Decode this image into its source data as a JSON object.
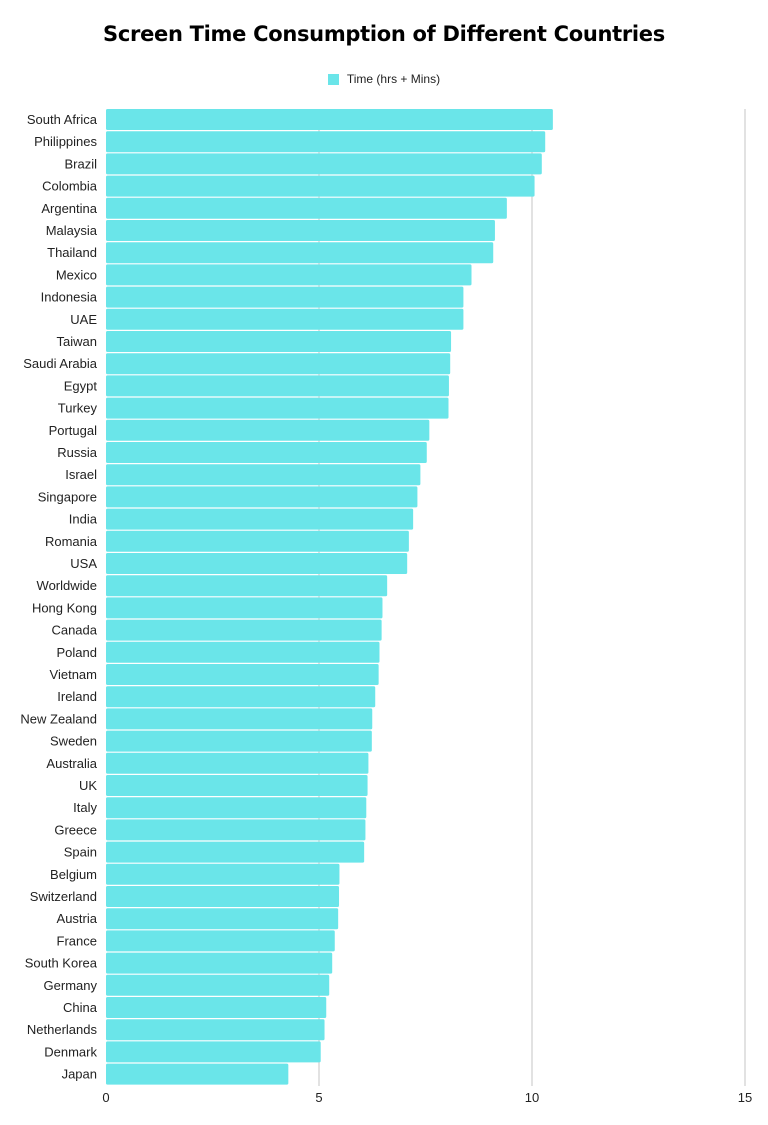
{
  "chart_data": {
    "type": "bar",
    "orientation": "horizontal",
    "title": "Screen Time Consumption of Different Countries",
    "xlabel": "",
    "ylabel": "",
    "xlim": [
      0,
      15
    ],
    "xticks": [
      0,
      5,
      10,
      15
    ],
    "grid": true,
    "legend_position": "top-center",
    "bar_color": "#6ae5e9",
    "categories": [
      "South Africa",
      "Philippines",
      "Brazil",
      "Colombia",
      "Argentina",
      "Malaysia",
      "Thailand",
      "Mexico",
      "Indonesia",
      "UAE",
      "Taiwan",
      "Saudi Arabia",
      "Egypt",
      "Turkey",
      "Portugal",
      "Russia",
      "Israel",
      "Singapore",
      "India",
      "Romania",
      "USA",
      "Worldwide",
      "Hong Kong",
      "Canada",
      "Poland",
      "Vietnam",
      "Ireland",
      "New Zealand",
      "Sweden",
      "Australia",
      "UK",
      "Italy",
      "Greece",
      "Spain",
      "Belgium",
      "Switzerland",
      "Austria",
      "France",
      "South Korea",
      "Germany",
      "China",
      "Netherlands",
      "Denmark",
      "Japan"
    ],
    "series": [
      {
        "name": "Time (hrs + Mins)",
        "values": [
          10.49,
          10.31,
          10.23,
          10.06,
          9.41,
          9.13,
          9.09,
          8.58,
          8.39,
          8.39,
          8.1,
          8.08,
          8.05,
          8.04,
          7.59,
          7.53,
          7.38,
          7.31,
          7.21,
          7.11,
          7.07,
          6.6,
          6.49,
          6.47,
          6.42,
          6.4,
          6.32,
          6.25,
          6.24,
          6.16,
          6.14,
          6.11,
          6.09,
          6.06,
          5.48,
          5.47,
          5.45,
          5.37,
          5.31,
          5.24,
          5.17,
          5.13,
          5.04,
          4.28
        ]
      }
    ]
  }
}
